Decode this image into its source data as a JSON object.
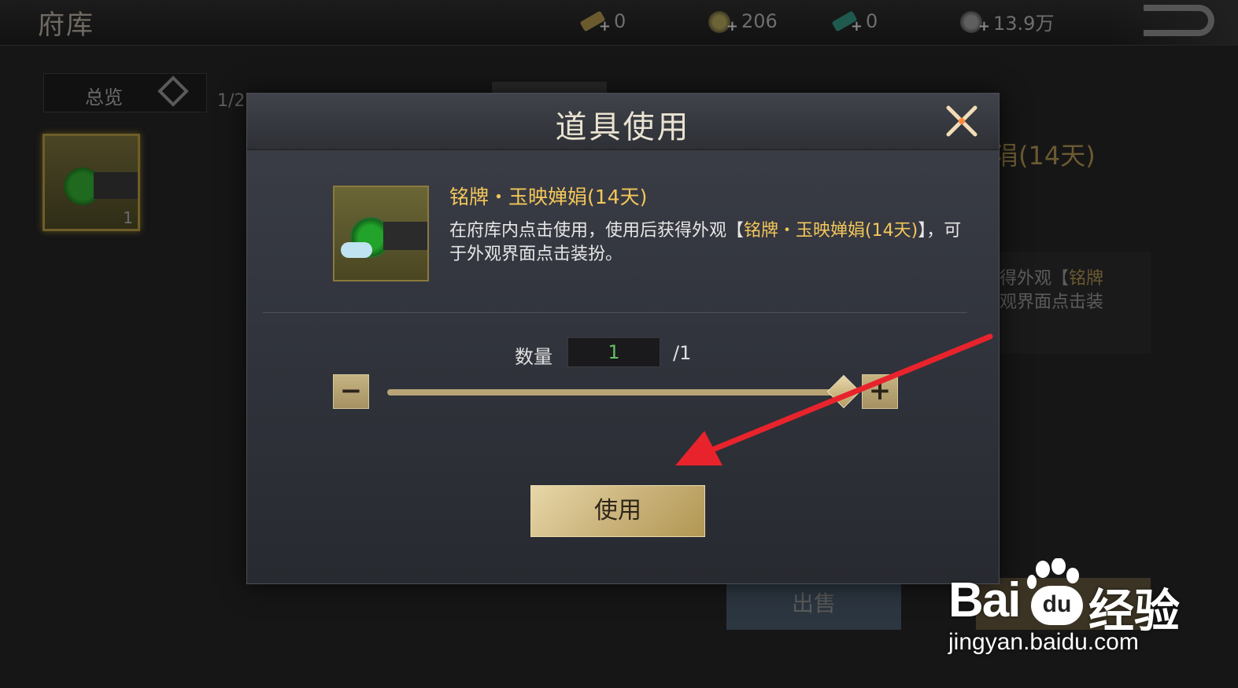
{
  "page": {
    "title": "府库",
    "resources": [
      {
        "icon": "gold-ingot-icon",
        "value": "0"
      },
      {
        "icon": "copper-coin-icon",
        "value": "206"
      },
      {
        "icon": "jade-icon",
        "value": "0"
      },
      {
        "icon": "silver-coin-icon",
        "value": "13.9万"
      }
    ],
    "filter_label": "总览",
    "page_count": "1/2",
    "inventory": [
      {
        "count": "1"
      }
    ],
    "detail": {
      "name_fragment": "涓(14天)",
      "desc_line1_plain": "得外观【",
      "desc_line1_hl": "铭牌",
      "desc_line2": "观界面点击装"
    },
    "sell_label": "出售"
  },
  "dialog": {
    "title": "道具使用",
    "item_name": "铭牌・玉映婵娟(14天)",
    "desc_prefix": "在府库内点击使用，使用后获得外观【",
    "desc_highlight": "铭牌・玉映婵娟(14天)",
    "desc_suffix": "】，可于外观界面点击装扮。",
    "quantity_label": "数量",
    "quantity_value": "1",
    "quantity_max": "/1",
    "slider_level": 1.0,
    "minus_label": "−",
    "plus_label": "+",
    "use_label": "使用"
  },
  "watermark": {
    "brand_bai": "Bai",
    "brand_du": "du",
    "brand_jingyan": "经验",
    "url": "jingyan.baidu.com"
  },
  "colors": {
    "accent_gold": "#f3c65a",
    "button_gold": "#c8b078",
    "qty_green": "#5fc35f",
    "arrow_red": "#e8232c"
  }
}
